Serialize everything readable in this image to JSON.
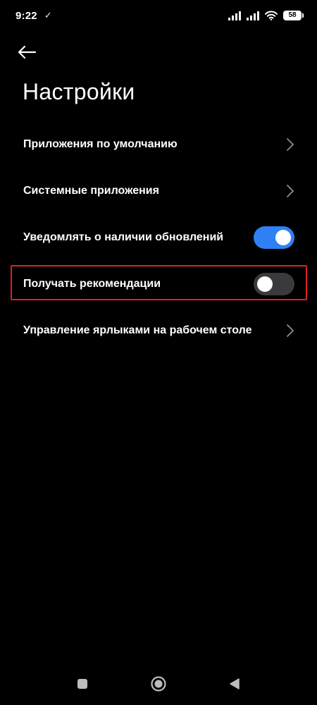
{
  "status_bar": {
    "time": "9:22",
    "check_glyph": "✓",
    "battery": "58",
    "icons": [
      "signal-icon",
      "signal-icon",
      "wifi-icon",
      "battery-icon"
    ]
  },
  "header": {
    "back_icon": "arrow-left-icon",
    "title": "Настройки"
  },
  "settings": [
    {
      "label": "Приложения по умолчанию",
      "control": "chevron"
    },
    {
      "label": "Системные приложения",
      "control": "chevron"
    },
    {
      "label": "Уведомлять о наличии обновлений",
      "control": "toggle",
      "checked": true
    },
    {
      "label": "Получать рекомендации",
      "control": "toggle",
      "checked": false,
      "highlighted": true
    },
    {
      "label": "Управление ярлыками на рабочем столе",
      "control": "chevron"
    }
  ],
  "colors": {
    "background": "#000000",
    "text": "#ffffff",
    "toggle_on": "#2f80f5",
    "toggle_off": "#3a3a3c",
    "chevron": "#8e8e93",
    "highlight": "#e02020",
    "nav_icon": "#bdbdbd"
  },
  "nav_bar": {
    "icons": [
      "square-icon",
      "circle-home-icon",
      "triangle-back-icon"
    ]
  }
}
